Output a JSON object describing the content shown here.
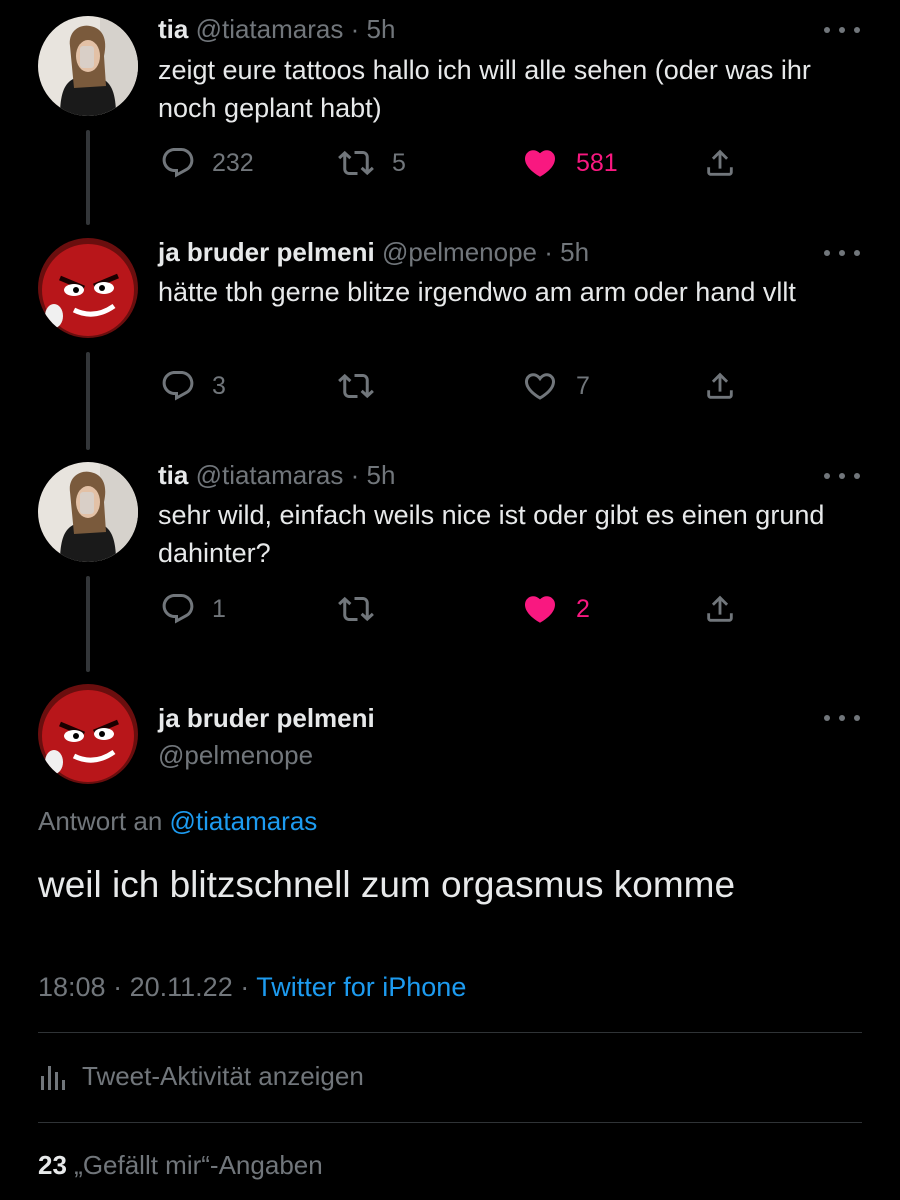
{
  "tweets": [
    {
      "name": "tia",
      "handle": "@tiatamaras",
      "sep": "·",
      "time": "5h",
      "text": "zeigt eure tattoos hallo ich will alle sehen (oder was ihr noch geplant habt)",
      "replies": "232",
      "retweets": "5",
      "likes": "581",
      "liked": true
    },
    {
      "name": "ja bruder pelmeni",
      "handle": "@pelmenope",
      "sep": "·",
      "time": "5h",
      "text": "hätte tbh gerne blitze irgendwo am arm oder hand vllt",
      "replies": "3",
      "retweets": "",
      "likes": "7",
      "liked": false
    },
    {
      "name": "tia",
      "handle": "@tiatamaras",
      "sep": "·",
      "time": "5h",
      "text": "sehr wild, einfach weils nice ist oder gibt es einen grund dahinter?",
      "replies": "1",
      "retweets": "",
      "likes": "2",
      "liked": true
    }
  ],
  "main_tweet": {
    "name": "ja bruder pelmeni",
    "handle": "@pelmenope",
    "reply_prefix": "Antwort an",
    "reply_to": "@tiatamaras",
    "text": "weil ich blitzschnell zum orgasmus komme",
    "time": "18:08",
    "sep1": "·",
    "date": "20.11.22",
    "sep2": "·",
    "source": "Twitter for iPhone",
    "activity_label": "Tweet-Aktivität anzeigen",
    "likes_count": "23",
    "likes_label": "„Gefällt mir“-Angaben"
  },
  "colors": {
    "background": "#000000",
    "text": "#e7e9ea",
    "muted": "#71767b",
    "link": "#1d9bf0",
    "like": "#f91880"
  },
  "icons": [
    "reply-icon",
    "retweet-icon",
    "heart-icon",
    "share-icon",
    "more-icon",
    "activity-icon"
  ]
}
